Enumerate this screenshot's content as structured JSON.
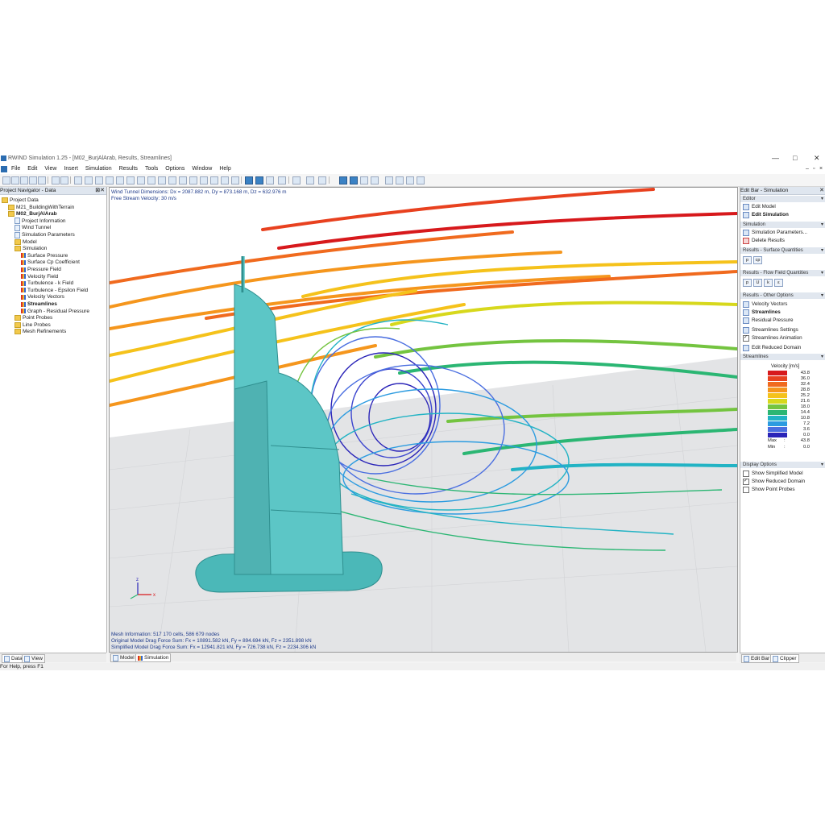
{
  "window": {
    "title": "RWIND Simulation 1.25 - [M02_BurjAlArab, Results, Streamlines]",
    "min": "—",
    "max": "□",
    "close": "✕"
  },
  "menu": [
    "File",
    "Edit",
    "View",
    "Insert",
    "Simulation",
    "Results",
    "Tools",
    "Options",
    "Window",
    "Help"
  ],
  "navigator": {
    "header": "Project Navigator - Data",
    "nodes": [
      {
        "label": "Project Data",
        "depth": 0,
        "icon": "folder-icon",
        "bold": false
      },
      {
        "label": "M21_BuildingWithTerrain",
        "depth": 1,
        "icon": "folder-icon",
        "bold": false
      },
      {
        "label": "M02_BurjAlArab",
        "depth": 1,
        "icon": "folder-icon",
        "bold": true
      },
      {
        "label": "Project Information",
        "depth": 2,
        "icon": "doc-icon",
        "bold": false
      },
      {
        "label": "Wind Tunnel",
        "depth": 2,
        "icon": "doc-icon",
        "bold": false
      },
      {
        "label": "Simulation Parameters",
        "depth": 2,
        "icon": "doc-icon",
        "bold": false
      },
      {
        "label": "Model",
        "depth": 2,
        "icon": "folder-icon",
        "bold": false
      },
      {
        "label": "Simulation",
        "depth": 2,
        "icon": "folder-icon",
        "bold": false
      },
      {
        "label": "Surface Pressure",
        "depth": 3,
        "icon": "result-icon",
        "bold": false
      },
      {
        "label": "Surface Cp Coefficient",
        "depth": 3,
        "icon": "result-icon",
        "bold": false
      },
      {
        "label": "Pressure Field",
        "depth": 3,
        "icon": "result-icon",
        "bold": false
      },
      {
        "label": "Velocity Field",
        "depth": 3,
        "icon": "result-icon",
        "bold": false
      },
      {
        "label": "Turbulence - k Field",
        "depth": 3,
        "icon": "result-icon",
        "bold": false
      },
      {
        "label": "Turbulence - Epsilon Field",
        "depth": 3,
        "icon": "result-icon",
        "bold": false
      },
      {
        "label": "Velocity Vectors",
        "depth": 3,
        "icon": "result-icon",
        "bold": false
      },
      {
        "label": "Streamlines",
        "depth": 3,
        "icon": "result-icon",
        "bold": true
      },
      {
        "label": "Graph - Residual Pressure",
        "depth": 3,
        "icon": "result-icon",
        "bold": false
      },
      {
        "label": "Point Probes",
        "depth": 2,
        "icon": "folder-icon",
        "bold": false
      },
      {
        "label": "Line Probes",
        "depth": 2,
        "icon": "folder-icon",
        "bold": false
      },
      {
        "label": "Mesh Refinements",
        "depth": 2,
        "icon": "folder-icon",
        "bold": false
      }
    ],
    "tabs": [
      "Data",
      "View"
    ]
  },
  "viewport": {
    "line1": "Wind Tunnel Dimensions: Dx = 2087.882 m, Dy = 873.168 m, Dz = 632.976 m",
    "line2": "Free Stream Velocity: 30 m/s",
    "mesh": "Mesh Information: 517 170 cells, 586 679 nodes",
    "orig": "Original Model Drag Force Sum: Fx = 10891.582 kN, Fy = 894.694 kN, Fz = 2351.898 kN",
    "simp": "Simplified Model Drag Force Sum: Fx = 12941.821 kN, Fy = 726.738 kN, Fz = 2234.306 kN",
    "axis_z": "z",
    "axis_x": "x",
    "tabs": [
      "Model",
      "Simulation"
    ]
  },
  "editbar": {
    "header": "Edit Bar - Simulation",
    "sections": {
      "editor": "Editor",
      "simulation": "Simulation",
      "surface": "Results - Surface Quantities",
      "flow": "Results - Flow Field Quantities",
      "other": "Results - Other Options",
      "streamlines": "Streamlines",
      "display": "Display Options"
    },
    "edit_model": "Edit Model",
    "edit_simulation": "Edit Simulation",
    "sim_params": "Simulation Parameters...",
    "delete_results": "Delete Results",
    "surface_buttons": [
      "p",
      "cp"
    ],
    "flow_buttons": [
      "p",
      "U",
      "k",
      "ε"
    ],
    "velocity_vectors": "Velocity Vectors",
    "streamlines": "Streamlines",
    "residual_pressure": "Residual Pressure",
    "streamlines_settings": "Streamlines Settings",
    "streamlines_animation": "Streamlines Animation",
    "edit_reduced_domain": "Edit Reduced Domain",
    "legend_title": "Velocity [m/s]",
    "legend": [
      {
        "value": "43.8",
        "color": "#d7191c"
      },
      {
        "value": "36.0",
        "color": "#e8411f"
      },
      {
        "value": "32.4",
        "color": "#f06a1e"
      },
      {
        "value": "28.8",
        "color": "#f5961d"
      },
      {
        "value": "25.2",
        "color": "#f5c21b"
      },
      {
        "value": "21.6",
        "color": "#d7d81c"
      },
      {
        "value": "18.0",
        "color": "#74c440"
      },
      {
        "value": "14.4",
        "color": "#2bb673"
      },
      {
        "value": "10.8",
        "color": "#22b3c4"
      },
      {
        "value": "7.2",
        "color": "#2b9be0"
      },
      {
        "value": "3.6",
        "color": "#4a6ee0"
      },
      {
        "value": "0.0",
        "color": "#2a24b8"
      }
    ],
    "max_label": "Max",
    "max_value": "43.8",
    "min_label": "Min",
    "min_value": "0.0",
    "show_simplified": "Show Simplified Model",
    "show_reduced": "Show Reduced Domain",
    "show_probes": "Show Point Probes",
    "tabs": [
      "Edit Bar",
      "Clipper"
    ]
  },
  "status": "For Help, press F1"
}
